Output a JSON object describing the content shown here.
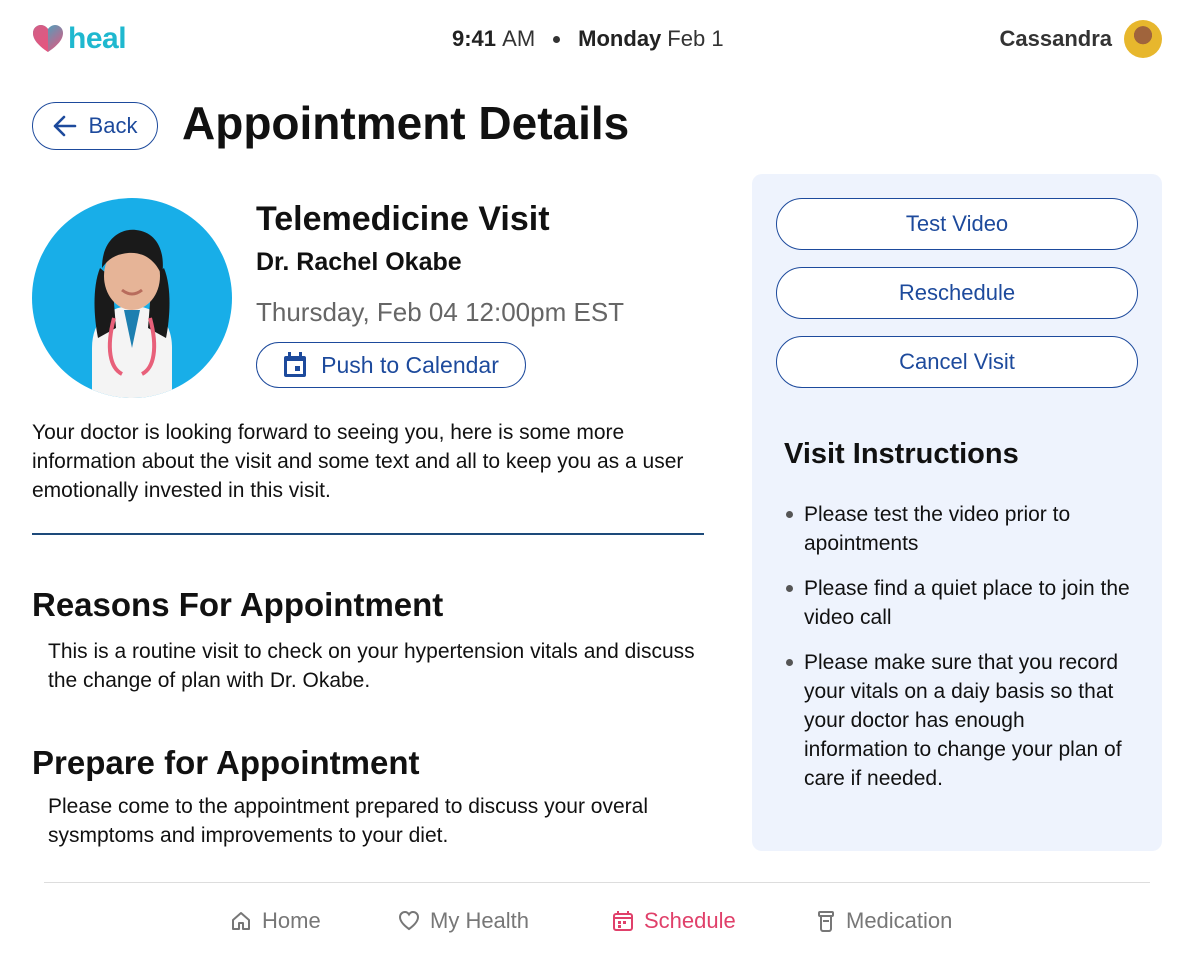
{
  "app": {
    "brand": "heal",
    "brand_color": "#1fb8cf",
    "accent_color": "#1d4a9c",
    "active_color": "#e0406a"
  },
  "status": {
    "time_bold": "9:41",
    "time_suffix": "AM",
    "day": "Monday",
    "date": "Feb 1"
  },
  "user": {
    "name": "Cassandra"
  },
  "header": {
    "back_label": "Back",
    "title": "Appointment Details"
  },
  "visit": {
    "type": "Telemedicine Visit",
    "doctor": "Dr. Rachel Okabe",
    "datetime": "Thursday, Feb 04 12:00pm EST",
    "calendar_label": "Push to Calendar",
    "intro": "Your doctor is looking forward to seeing you, here is some more information about the visit and some text and all to keep you as a user emotionally invested in this visit."
  },
  "reasons": {
    "heading": "Reasons For Appointment",
    "text": "This is a routine visit to check on your hypertension vitals and discuss the change of plan with Dr. Okabe."
  },
  "prepare": {
    "heading": "Prepare for Appointment",
    "text": "Please come to the appointment prepared to discuss your overal sysmptoms and improvements to your diet."
  },
  "panel": {
    "buttons": [
      "Test Video",
      "Reschedule",
      "Cancel Visit"
    ],
    "instructions_heading": "Visit Instructions",
    "instructions": [
      "Please test the video prior to apointments",
      "Please find a quiet place to join the video call",
      "Please make sure that you record your vitals on a daiy basis so that your doctor has enough information to change your plan of care if needed."
    ]
  },
  "nav": [
    {
      "label": "Home",
      "icon": "home-icon"
    },
    {
      "label": "My Health",
      "icon": "heart-icon"
    },
    {
      "label": "Schedule",
      "icon": "calendar-icon",
      "active": true
    },
    {
      "label": "Medication",
      "icon": "pill-bottle-icon"
    }
  ]
}
